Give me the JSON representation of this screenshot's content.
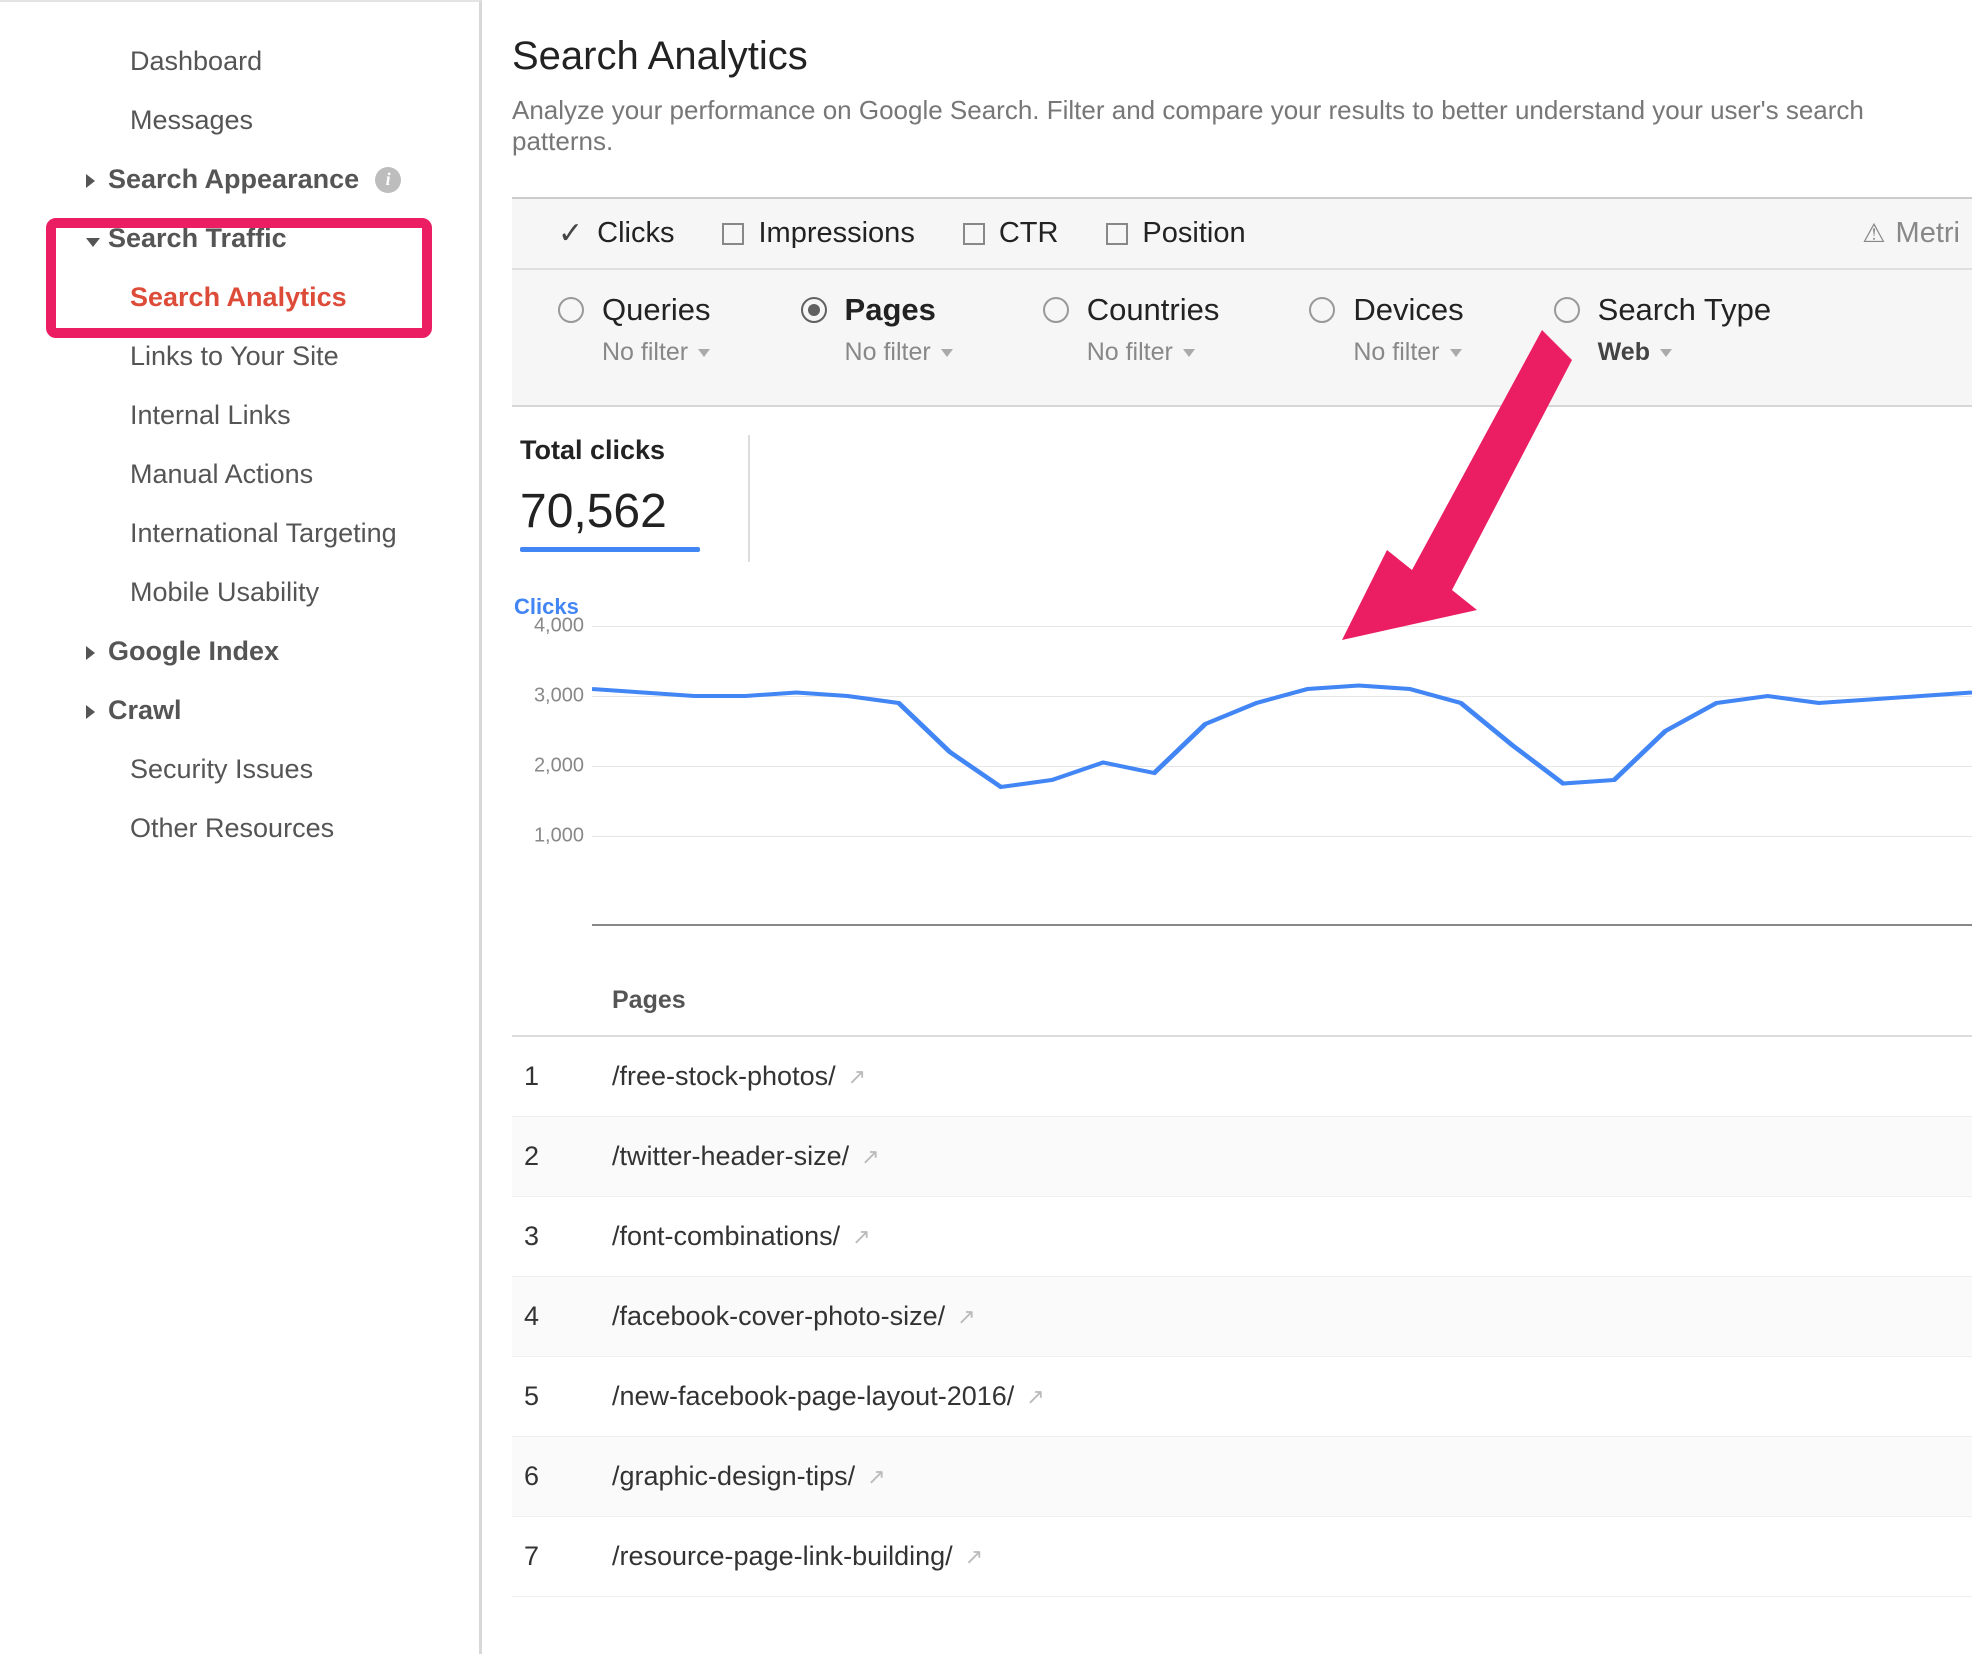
{
  "sidebar": {
    "items": [
      {
        "label": "Dashboard",
        "type": "top"
      },
      {
        "label": "Messages",
        "type": "top"
      },
      {
        "label": "Search Appearance",
        "type": "section",
        "caret": "right",
        "info": true
      },
      {
        "label": "Search Traffic",
        "type": "section",
        "caret": "down",
        "open": true,
        "children": [
          {
            "label": "Search Analytics",
            "active": true
          },
          {
            "label": "Links to Your Site"
          },
          {
            "label": "Internal Links"
          },
          {
            "label": "Manual Actions"
          },
          {
            "label": "International Targeting"
          },
          {
            "label": "Mobile Usability"
          }
        ]
      },
      {
        "label": "Google Index",
        "type": "section",
        "caret": "right"
      },
      {
        "label": "Crawl",
        "type": "section",
        "caret": "right"
      },
      {
        "label": "Security Issues",
        "type": "top"
      },
      {
        "label": "Other Resources",
        "type": "top"
      }
    ]
  },
  "header": {
    "title": "Search Analytics",
    "subtitle": "Analyze your performance on Google Search. Filter and compare your results to better understand your user's search patterns."
  },
  "metrics": {
    "items": [
      {
        "label": "Clicks",
        "checked": true
      },
      {
        "label": "Impressions",
        "checked": false
      },
      {
        "label": "CTR",
        "checked": false
      },
      {
        "label": "Position",
        "checked": false
      }
    ],
    "warning_label": "Metri"
  },
  "dimensions": {
    "items": [
      {
        "label": "Queries",
        "filter": "No filter",
        "selected": false
      },
      {
        "label": "Pages",
        "filter": "No filter",
        "selected": true
      },
      {
        "label": "Countries",
        "filter": "No filter",
        "selected": false
      },
      {
        "label": "Devices",
        "filter": "No filter",
        "selected": false
      },
      {
        "label": "Search Type",
        "filter": "Web",
        "selected": false,
        "filter_plain": true
      }
    ]
  },
  "totals": {
    "label": "Total clicks",
    "value": "70,562"
  },
  "chart_legend": "Clicks",
  "chart_data": {
    "type": "line",
    "title": "Clicks",
    "xlabel": "",
    "ylabel": "",
    "ylim": [
      0,
      4000
    ],
    "y_ticks": [
      1000,
      2000,
      3000,
      4000
    ],
    "x": [
      0,
      1,
      2,
      3,
      4,
      5,
      6,
      7,
      8,
      9,
      10,
      11,
      12,
      13,
      14,
      15,
      16,
      17,
      18,
      19,
      20,
      21,
      22,
      23,
      24,
      25,
      26,
      27
    ],
    "series": [
      {
        "name": "Clicks",
        "color": "#4285f4",
        "values": [
          3100,
          3050,
          3000,
          3000,
          3050,
          3000,
          2900,
          2200,
          1700,
          1800,
          2050,
          1900,
          2600,
          2900,
          3100,
          3150,
          3100,
          2900,
          2300,
          1750,
          1800,
          2500,
          2900,
          3000,
          2900,
          2950,
          3000,
          3050
        ]
      }
    ]
  },
  "table": {
    "column_header": "Pages",
    "rows": [
      {
        "n": "1",
        "page": "/free-stock-photos/"
      },
      {
        "n": "2",
        "page": "/twitter-header-size/"
      },
      {
        "n": "3",
        "page": "/font-combinations/"
      },
      {
        "n": "4",
        "page": "/facebook-cover-photo-size/"
      },
      {
        "n": "5",
        "page": "/new-facebook-page-layout-2016/"
      },
      {
        "n": "6",
        "page": "/graphic-design-tips/"
      },
      {
        "n": "7",
        "page": "/resource-page-link-building/"
      }
    ]
  },
  "icons": {
    "info": "i",
    "warning": "⚠",
    "external": "↗"
  }
}
